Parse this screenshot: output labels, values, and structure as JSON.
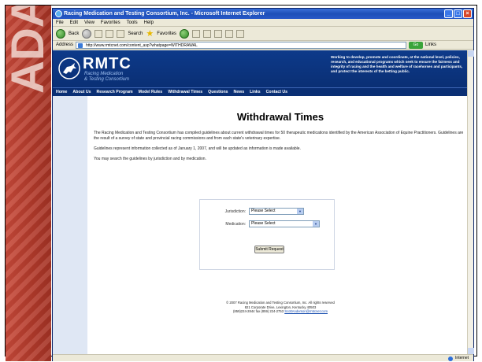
{
  "slide": {
    "banner_text": "ADAS"
  },
  "browser": {
    "title": "Racing Medication and Testing Consortium, Inc. - Microsoft Internet Explorer",
    "menu": [
      "File",
      "Edit",
      "View",
      "Favorites",
      "Tools",
      "Help"
    ],
    "toolbar": {
      "back_label": "Back",
      "search_label": "Search",
      "favorites_label": "Favorites"
    },
    "address_label": "Address",
    "address_value": "http://www.rmtcnet.com/content_asp?whatpage=WITHDRAWAL",
    "go_label": "Go",
    "links_label": "Links",
    "status_zone": "Internet"
  },
  "site": {
    "logo": "RMTC",
    "logo_sub1": "Racing Medication",
    "logo_sub2": "& Testing Consortium",
    "mission": "Working to develop, promote and coordinate, at the national level, policies, research, and educational programs which seek to ensure the fairness and integrity of racing and the health and welfare of racehorses and participants, and protect the interests of the betting public.",
    "nav": [
      "Home",
      "About Us",
      "Research Program",
      "Model Rules",
      "Withdrawal Times",
      "Questions",
      "News",
      "Links",
      "Contact Us"
    ]
  },
  "page": {
    "title": "Withdrawal Times",
    "para1": "The Racing Medication and Testing Consortium has compiled guidelines about current withdrawal times for 50 therapeutic medications identified by the American Association of Equine Practitioners. Guidelines are the result of a survey of state and provincial racing commissions and from each state's veterinary expertise.",
    "para2": "Guidelines represent information collected as of January 1, 2007, and will be updated as information is made available.",
    "para3": "You may search the guidelines by jurisdiction and by medication.",
    "form": {
      "jurisdiction_label": "Jurisdiction:",
      "jurisdiction_value": "Please Select",
      "medication_label": "Medication:",
      "medication_value": "Please Select",
      "submit_label": "Submit Request"
    },
    "footer": {
      "line1": "© 2007 Racing Medication and Testing Consortium, Inc. All rights reserved",
      "line2": "821 Corporate Drive, Lexington, Kentucky 40503",
      "line3_phone": "(859)224-2844 fax (859) 224-2753",
      "line3_email": "ScottAnderson@rmtcnet.com"
    }
  }
}
